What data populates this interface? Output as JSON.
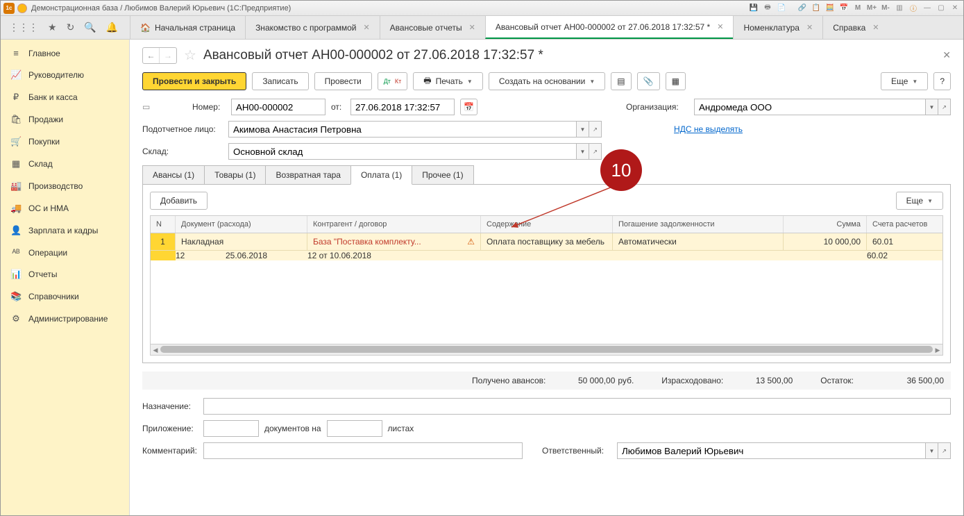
{
  "window": {
    "title": "Демонстрационная база / Любимов Валерий Юрьевич  (1С:Предприятие)",
    "m": "M",
    "mplus": "M+",
    "mminus": "M-"
  },
  "tabs": {
    "home": "Начальная страница",
    "t1": "Знакомство с программой",
    "t2": "Авансовые отчеты",
    "t3": "Авансовый отчет АН00-000002 от 27.06.2018 17:32:57 *",
    "t4": "Номенклатура",
    "t5": "Справка"
  },
  "sidebar": {
    "items": [
      {
        "icon": "≡",
        "label": "Главное"
      },
      {
        "icon": "📈",
        "label": "Руководителю"
      },
      {
        "icon": "₽",
        "label": "Банк и касса"
      },
      {
        "icon": "🛍",
        "label": "Продажи"
      },
      {
        "icon": "🛒",
        "label": "Покупки"
      },
      {
        "icon": "▦",
        "label": "Склад"
      },
      {
        "icon": "🏭",
        "label": "Производство"
      },
      {
        "icon": "🚚",
        "label": "ОС и НМА"
      },
      {
        "icon": "👤",
        "label": "Зарплата и кадры"
      },
      {
        "icon": "ᴬᴮ",
        "label": "Операции"
      },
      {
        "icon": "📊",
        "label": "Отчеты"
      },
      {
        "icon": "📚",
        "label": "Справочники"
      },
      {
        "icon": "⚙",
        "label": "Администрирование"
      }
    ]
  },
  "page": {
    "title": "Авансовый отчет АН00-000002 от 27.06.2018 17:32:57 *"
  },
  "toolbar": {
    "post_close": "Провести и закрыть",
    "save": "Записать",
    "post": "Провести",
    "print": "Печать",
    "create_basis": "Создать на основании",
    "more": "Еще"
  },
  "form": {
    "number_label": "Номер:",
    "number": "АН00-000002",
    "from_label": "от:",
    "date": "27.06.2018 17:32:57",
    "org_label": "Организация:",
    "org": "Андромеда ООО",
    "person_label": "Подотчетное лицо:",
    "person": "Акимова Анастасия Петровна",
    "vat_link": "НДС не выделять",
    "warehouse_label": "Склад:",
    "warehouse": "Основной склад"
  },
  "doc_tabs": {
    "t1": "Авансы (1)",
    "t2": "Товары (1)",
    "t3": "Возвратная тара",
    "t4": "Оплата (1)",
    "t5": "Прочее (1)"
  },
  "panel": {
    "add": "Добавить",
    "more": "Еще"
  },
  "table": {
    "headers": {
      "n": "N",
      "doc": "Документ (расхода)",
      "ctr": "Контрагент / договор",
      "cont": "Содержание",
      "pog": "Погашение задолженности",
      "sum": "Сумма",
      "acc": "Счета расчетов"
    },
    "row1": {
      "n": "1",
      "doc": "Накладная",
      "ctr": "База \"Поставка комплекту...",
      "cont": "Оплата поставщику за мебель",
      "pog": "Автоматически",
      "sum": "10 000,00",
      "acc": "60.01"
    },
    "row2": {
      "doc_num": "12",
      "doc_date": "25.06.2018",
      "ctr": "12 от 10.06.2018",
      "acc": "60.02"
    }
  },
  "totals": {
    "adv_label": "Получено авансов:",
    "adv": "50 000,00",
    "cur": "руб.",
    "spent_label": "Израсходовано:",
    "spent": "13 500,00",
    "rest_label": "Остаток:",
    "rest": "36 500,00"
  },
  "footer": {
    "purpose_label": "Назначение:",
    "attach_label": "Приложение:",
    "docs_on": "документов на",
    "sheets": "листах",
    "comment_label": "Комментарий:",
    "resp_label": "Ответственный:",
    "resp": "Любимов Валерий Юрьевич"
  },
  "callout": {
    "num": "10"
  }
}
